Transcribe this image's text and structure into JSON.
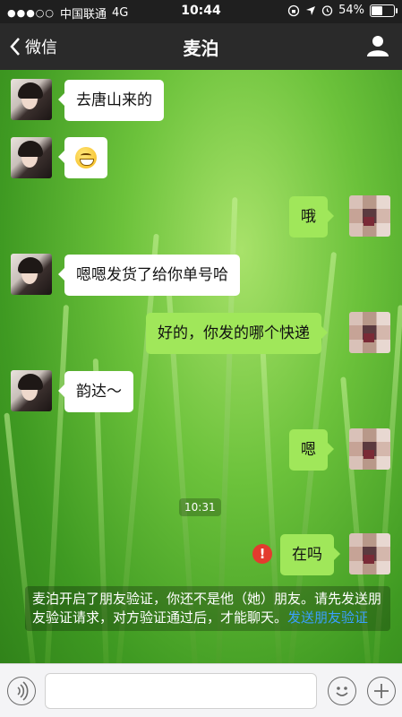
{
  "status": {
    "carrier": "中国联通",
    "network": "4G",
    "time": "10:44",
    "battery": "54%",
    "battery_level": 0.54
  },
  "nav": {
    "back_label": "微信",
    "title": "麦泊"
  },
  "messages": [
    {
      "side": "left",
      "text": "去唐山来的"
    },
    {
      "side": "left",
      "text": "",
      "emoji": "grin-emoji"
    },
    {
      "side": "right",
      "text": "哦"
    },
    {
      "side": "left",
      "text": "嗯嗯发货了给你单号哈"
    },
    {
      "side": "right",
      "text": "好的，你发的哪个快递"
    },
    {
      "side": "left",
      "text": "韵达～"
    },
    {
      "side": "right",
      "text": "嗯"
    },
    {
      "side": "right",
      "text": "在吗",
      "failed": true
    }
  ],
  "timestamp": "10:31",
  "error_mark": "!",
  "notice": {
    "text": "麦泊开启了朋友验证，你还不是他（她）朋友。请先发送朋友验证请求，对方验证通过后，才能聊天。",
    "link": "发送朋友验证"
  },
  "colors": {
    "bubble_self": "#a0e75a",
    "bubble_other": "#ffffff",
    "error": "#e33b2e",
    "link": "#3aa0ff"
  }
}
